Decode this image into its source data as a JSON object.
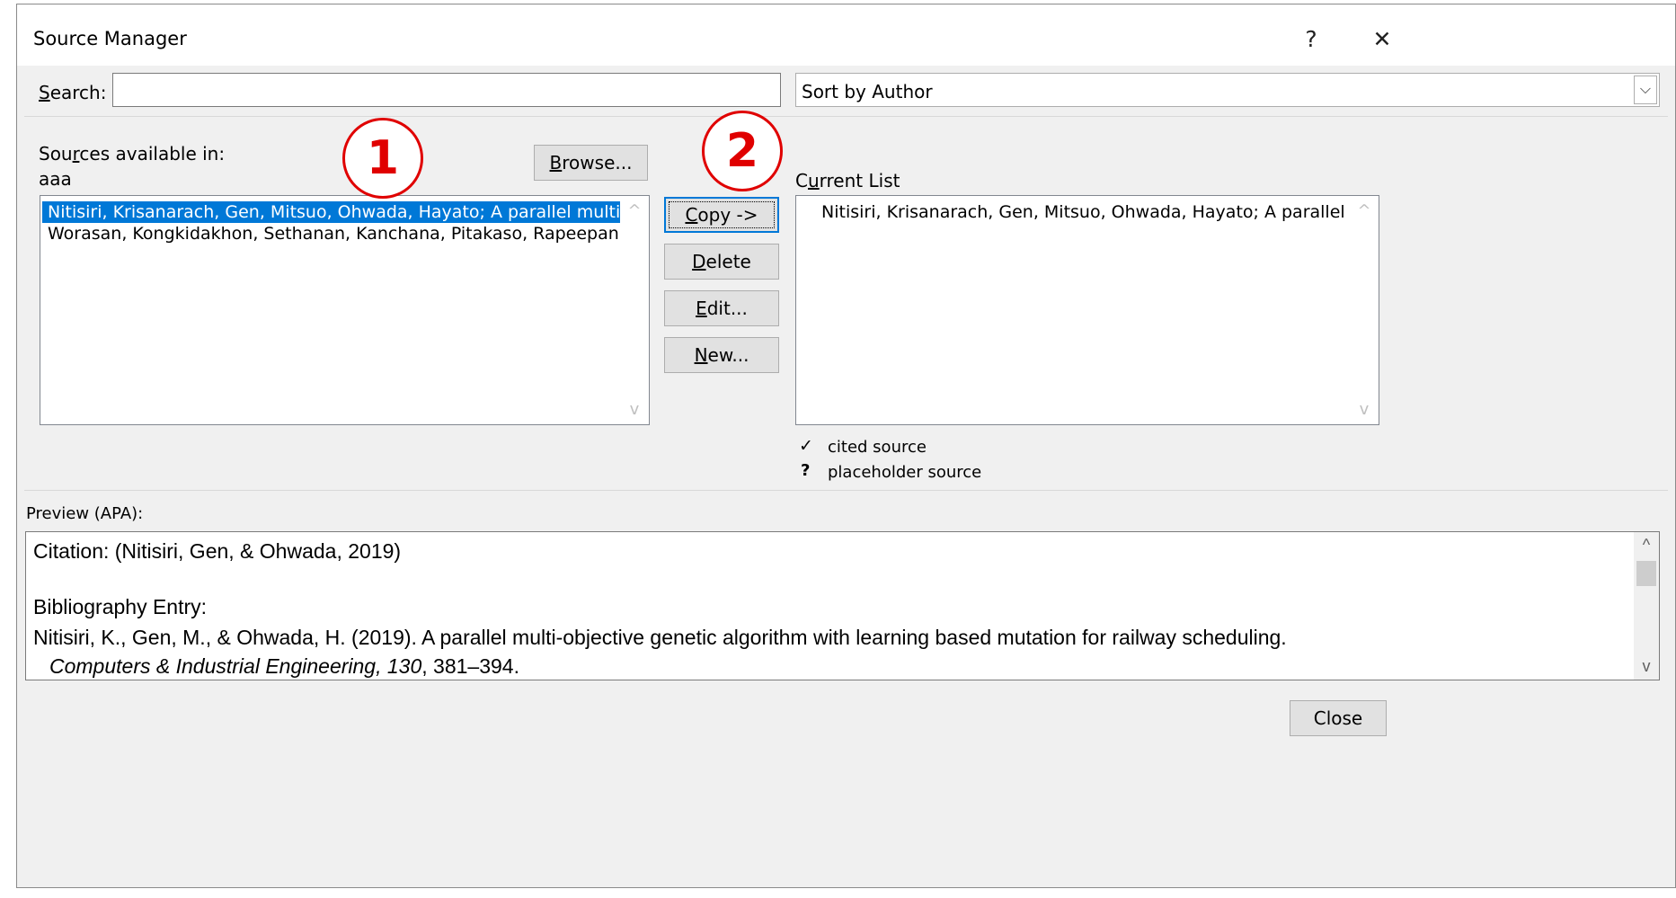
{
  "window": {
    "title": "Source Manager",
    "help_label": "?",
    "close_label": "✕"
  },
  "search": {
    "label_pre": "",
    "label_accel": "S",
    "label_post": "earch:",
    "value": ""
  },
  "sort": {
    "selected": "Sort by Author",
    "dropdown_glyph": "⌵"
  },
  "sources_available": {
    "label_pre": "Sou",
    "label_accel": "r",
    "label_post": "ces available in:",
    "location": "aaa",
    "browse_accel": "B",
    "browse_rest": "rowse...",
    "items": [
      "Nitisiri, Krisanarach, Gen, Mitsuo, Ohwada, Hayato; A parallel multi-obje",
      "Worasan, Kongkidakhon, Sethanan, Kanchana, Pitakaso, Rapeepan, Mc"
    ]
  },
  "annotations": {
    "one": "1",
    "two": "2"
  },
  "actions": {
    "copy_accel": "C",
    "copy_rest": "opy ->",
    "delete_accel": "D",
    "delete_rest": "elete",
    "edit_accel": "E",
    "edit_rest": "dit...",
    "new_accel": "N",
    "new_rest": "ew..."
  },
  "current_list": {
    "label_pre": "C",
    "label_accel": "u",
    "label_post": "rrent List",
    "items": [
      "Nitisiri, Krisanarach, Gen, Mitsuo, Ohwada, Hayato; A parallel multi-ol"
    ]
  },
  "legend": {
    "cited_symbol": "✓",
    "cited_label": "cited source",
    "placeholder_symbol": "?",
    "placeholder_label": "placeholder source"
  },
  "preview": {
    "label": "Preview (APA):",
    "citation": "Citation:  (Nitisiri, Gen, & Ohwada, 2019)",
    "bib_heading": "Bibliography Entry:",
    "bib_line1": "Nitisiri, K., Gen, M., & Ohwada, H. (2019). A parallel multi-objective genetic algorithm with learning based mutation for railway scheduling.",
    "bib_journal": "Computers & Industrial Engineering, 130",
    "bib_pages": ", 381–394."
  },
  "footer": {
    "close_label": "Close"
  }
}
